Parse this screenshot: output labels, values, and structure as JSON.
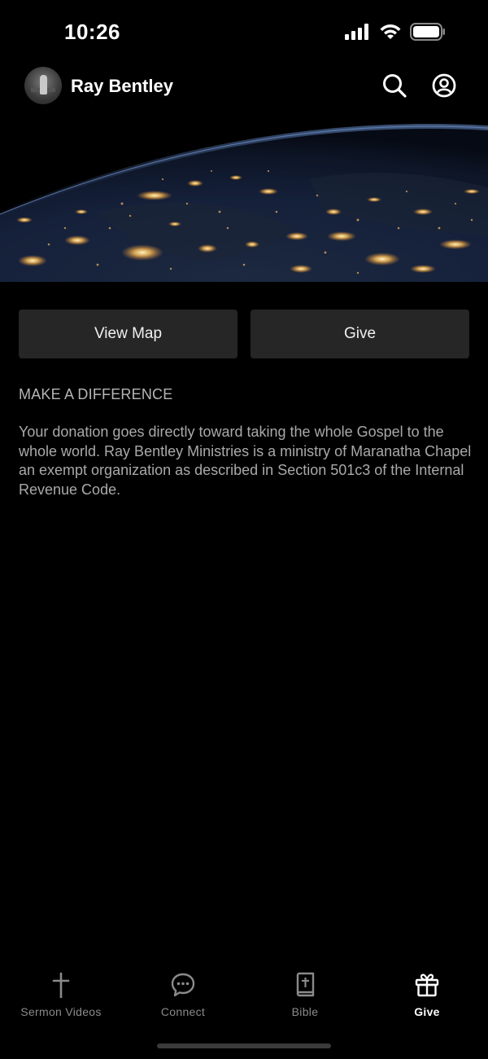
{
  "status_bar": {
    "time": "10:26"
  },
  "header": {
    "title": "Ray Bentley",
    "avatar_icon": "person-at-pulpit-avatar",
    "search_icon": "search-icon",
    "profile_icon": "profile-icon"
  },
  "hero": {
    "image": "earth-from-space-night-lights"
  },
  "actions": {
    "view_map_label": "View Map",
    "give_label": "Give"
  },
  "section": {
    "title": "MAKE A DIFFERENCE",
    "body": "Your donation goes directly toward taking the whole Gospel to the whole world. Ray Bentley Ministries is a ministry of Maranatha Chapel an exempt organization as described in Section 501c3 of the Internal Revenue Code."
  },
  "tabs": [
    {
      "label": "Sermon Videos",
      "icon": "cross-icon",
      "active": false
    },
    {
      "label": "Connect",
      "icon": "chat-bubble-icon",
      "active": false
    },
    {
      "label": "Bible",
      "icon": "bible-icon",
      "active": false
    },
    {
      "label": "Give",
      "icon": "gift-icon",
      "active": true
    }
  ],
  "colors": {
    "background": "#000000",
    "button": "#262626",
    "text_muted": "#a9a9a9",
    "tab_inactive": "#8a8a8a"
  }
}
